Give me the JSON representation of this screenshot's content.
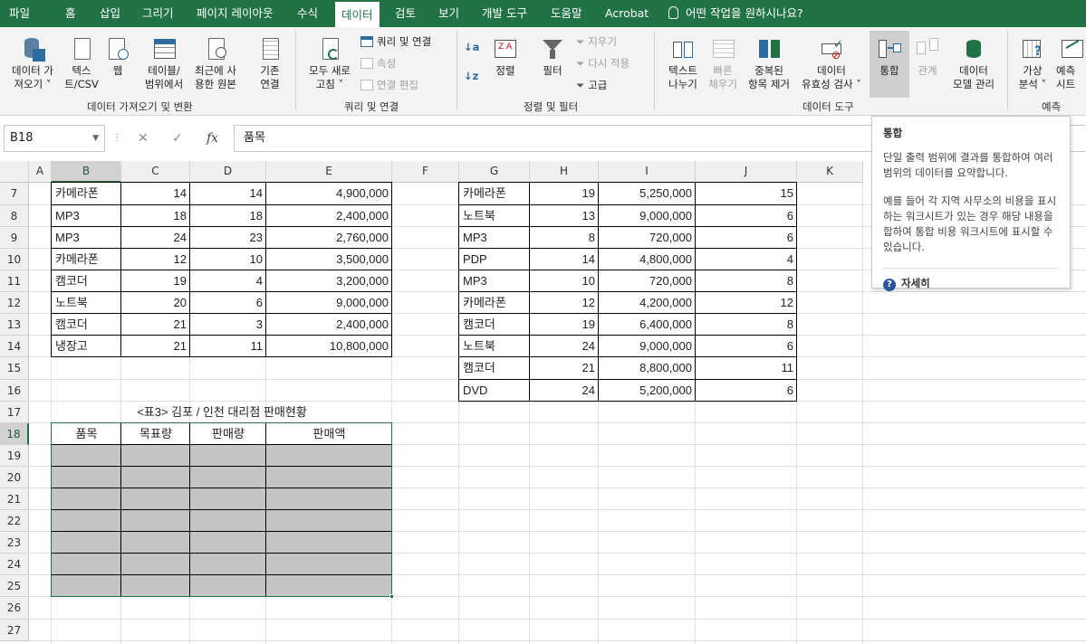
{
  "menu": {
    "tabs": [
      "파일",
      "홈",
      "삽입",
      "그리기",
      "페이지 레이아웃",
      "수식",
      "데이터",
      "검토",
      "보기",
      "개발 도구",
      "도움말",
      "Acrobat"
    ],
    "active": "데이터",
    "tell_me": "어떤 작업을 원하시나요?"
  },
  "ribbon": {
    "get_data": [
      "데이터 가",
      "져오기 ˅"
    ],
    "text_csv": [
      "텍스",
      "트/CSV"
    ],
    "web": [
      "웹"
    ],
    "table_range": [
      "테이블/",
      "범위에서"
    ],
    "recent_sources": [
      "최근에 사",
      "용한 원본"
    ],
    "existing_conn": [
      "기존",
      "연결"
    ],
    "group_get_transform": "데이터 가져오기 및 변환",
    "refresh_all": [
      "모두 새로",
      "고침 ˅"
    ],
    "queries_conn": "쿼리 및 연결",
    "properties": "속성",
    "edit_links": "연결 편집",
    "group_queries": "쿼리 및 연결",
    "sort": "정렬",
    "filter": "필터",
    "clear": "지우기",
    "reapply": "다시 적용",
    "advanced": "고급",
    "group_sort_filter": "정렬 및 필터",
    "text_to_columns": [
      "텍스트",
      "나누기"
    ],
    "flash_fill": [
      "빠른",
      "채우기"
    ],
    "remove_dup": [
      "중복된",
      "항목 제거"
    ],
    "data_validation": [
      "데이터",
      "유효성 검사 ˅"
    ],
    "consolidate": "통합",
    "relationships": "관계",
    "data_model": [
      "데이터",
      "모델 관리"
    ],
    "group_data_tools": "데이터 도구",
    "whatif": [
      "가상",
      "분석 ˅"
    ],
    "forecast": [
      "예측",
      "시트"
    ],
    "group_forecast": "예측"
  },
  "formula_bar": {
    "name_box": "B18",
    "cancel": "✕",
    "enter": "✓",
    "fx": "fx",
    "value": "품목"
  },
  "tooltip": {
    "title": "통합",
    "line1": "단일 출력 범위에 결과를 통합하여 여러 범위의 데이터를 요약합니다.",
    "line2": "예를 들어 각 지역 사무소의 비용을 표시하는 워크시트가 있는 경우 해당 내용을 합하여 통합 비용 워크시트에 표시할 수 있습니다.",
    "more": "자세히"
  },
  "columns": [
    "A",
    "B",
    "C",
    "D",
    "E",
    "F",
    "G",
    "H",
    "I",
    "J",
    "K"
  ],
  "rows": [
    "7",
    "8",
    "9",
    "10",
    "11",
    "12",
    "13",
    "14",
    "15",
    "16",
    "17",
    "18",
    "19",
    "20",
    "21",
    "22",
    "23",
    "24",
    "25",
    "26",
    "27"
  ],
  "table_left": [
    [
      "카메라폰",
      "14",
      "14",
      "4,900,000"
    ],
    [
      "MP3",
      "18",
      "18",
      "2,400,000"
    ],
    [
      "MP3",
      "24",
      "23",
      "2,760,000"
    ],
    [
      "카메라폰",
      "12",
      "10",
      "3,500,000"
    ],
    [
      "캠코더",
      "19",
      "4",
      "3,200,000"
    ],
    [
      "노트북",
      "20",
      "6",
      "9,000,000"
    ],
    [
      "캠코더",
      "21",
      "3",
      "2,400,000"
    ],
    [
      "냉장고",
      "21",
      "11",
      "10,800,000"
    ]
  ],
  "table_right": [
    [
      "카메라폰",
      "19",
      "5,250,000",
      "15"
    ],
    [
      "노트북",
      "13",
      "9,000,000",
      "6"
    ],
    [
      "MP3",
      "8",
      "720,000",
      "6"
    ],
    [
      "PDP",
      "14",
      "4,800,000",
      "4"
    ],
    [
      "MP3",
      "10",
      "720,000",
      "8"
    ],
    [
      "카메라폰",
      "12",
      "4,200,000",
      "12"
    ],
    [
      "캠코더",
      "19",
      "6,400,000",
      "8"
    ],
    [
      "노트북",
      "24",
      "9,000,000",
      "6"
    ],
    [
      "캠코더",
      "21",
      "8,800,000",
      "11"
    ],
    [
      "DVD",
      "24",
      "5,200,000",
      "6"
    ]
  ],
  "table3": {
    "title": "<표3> 김포 / 인천  대리점 판매현황",
    "headers": [
      "품목",
      "목표량",
      "판매량",
      "판매액"
    ]
  }
}
